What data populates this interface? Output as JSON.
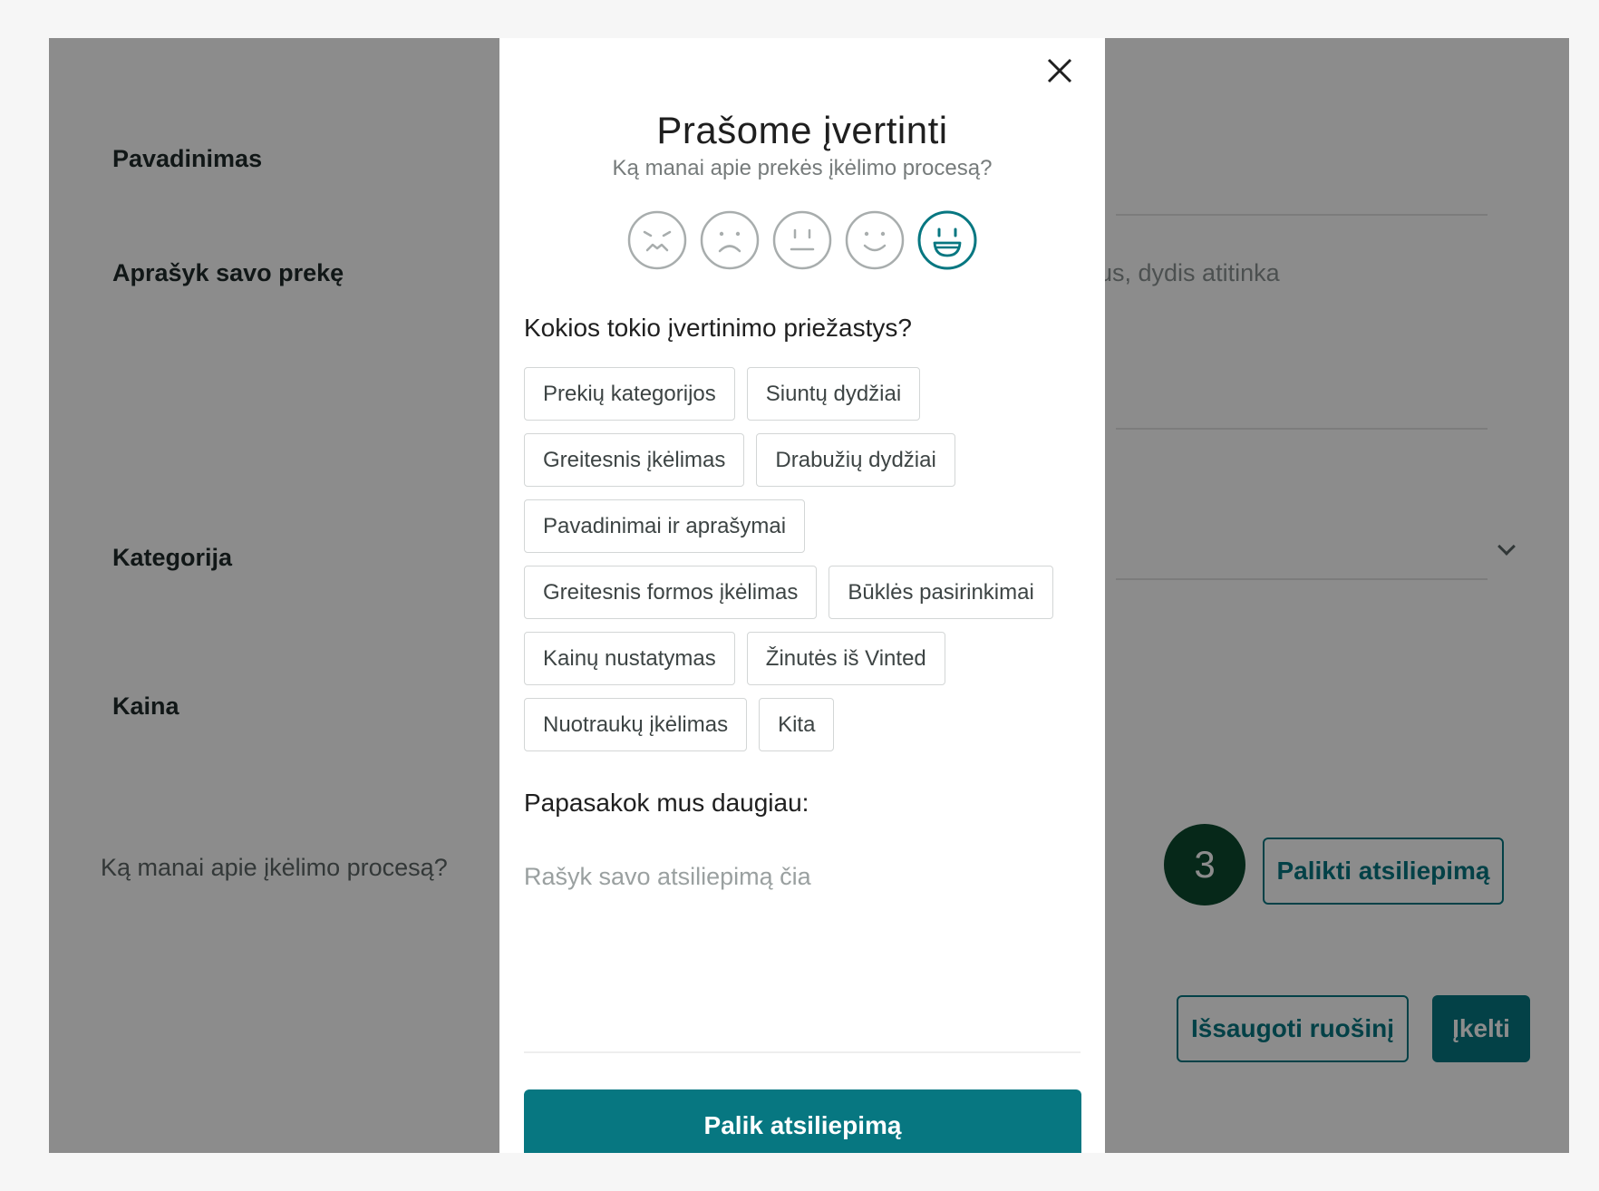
{
  "background_form": {
    "name_label": "Pavadinimas",
    "description_label": "Aprašyk savo prekę",
    "description_hint": "us, dydis atitinka",
    "category_label": "Kategorija",
    "price_label": "Kaina",
    "feedback_prompt": "Ką manai apie įkėlimo procesą?",
    "step_number": "3",
    "leave_feedback_button": "Palikti atsiliepimą",
    "save_draft_button": "Išsaugoti ruošinį",
    "upload_button": "Įkelti"
  },
  "modal": {
    "title": "Prašome įvertinti",
    "subtitle": "Ką manai apie prekės įkėlimo procesą?",
    "ratings": [
      {
        "name": "very-dissatisfied-face-icon",
        "selected": false
      },
      {
        "name": "dissatisfied-face-icon",
        "selected": false
      },
      {
        "name": "neutral-face-icon",
        "selected": false
      },
      {
        "name": "satisfied-face-icon",
        "selected": false
      },
      {
        "name": "very-satisfied-face-icon",
        "selected": true
      }
    ],
    "reasons_heading": "Kokios tokio įvertinimo priežastys?",
    "reasons": [
      [
        "Prekių kategorijos",
        "Siuntų dydžiai"
      ],
      [
        "Greitesnis įkėlimas",
        "Drabužių dydžiai"
      ],
      [
        "Pavadinimai ir aprašymai"
      ],
      [
        "Greitesnis formos įkėlimas",
        "Būklės pasirinkimai"
      ],
      [
        "Kainų nustatymas",
        "Žinutės iš Vinted"
      ],
      [
        "Nuotraukų įkėlimas",
        "Kita"
      ]
    ],
    "more_heading": "Papasakok mus daugiau:",
    "feedback_placeholder": "Rašyk savo atsiliepimą čia",
    "submit_label": "Palik atsiliepimą"
  },
  "colors": {
    "accent": "#077781",
    "badge": "#0b4a2e",
    "face_default": "#a8adad"
  }
}
